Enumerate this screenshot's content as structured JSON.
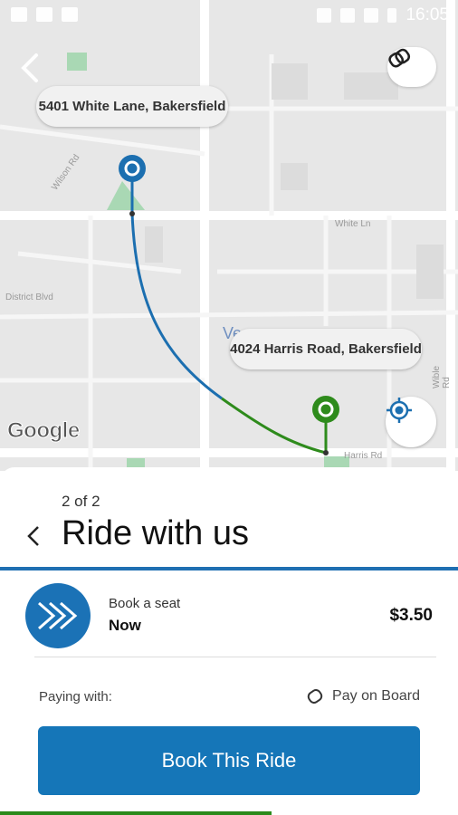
{
  "status_bar": {
    "time": "16:05"
  },
  "map": {
    "origin_label": "5401 White Lane, Bakersfield",
    "destination_label": "4024 Harris Road, Bakersfield",
    "street_labels": [
      "Wilson Rd",
      "White Ln",
      "District Blvd",
      "Harris Rd",
      "Wible Rd",
      "Ve"
    ],
    "google_logo": "Google",
    "route_color_start": "#1c6fb0",
    "route_color_end": "#2e8b1c"
  },
  "sheet": {
    "step": "2 of 2",
    "title": "Ride with us",
    "option": {
      "label": "Book a seat",
      "time": "Now",
      "price": "$3.50"
    },
    "paying_with_label": "Paying with:",
    "payment_method": "Pay on Board",
    "book_button": "Book This Ride"
  },
  "colors": {
    "primary": "#1576b8",
    "accent_green": "#2a8a1a"
  }
}
